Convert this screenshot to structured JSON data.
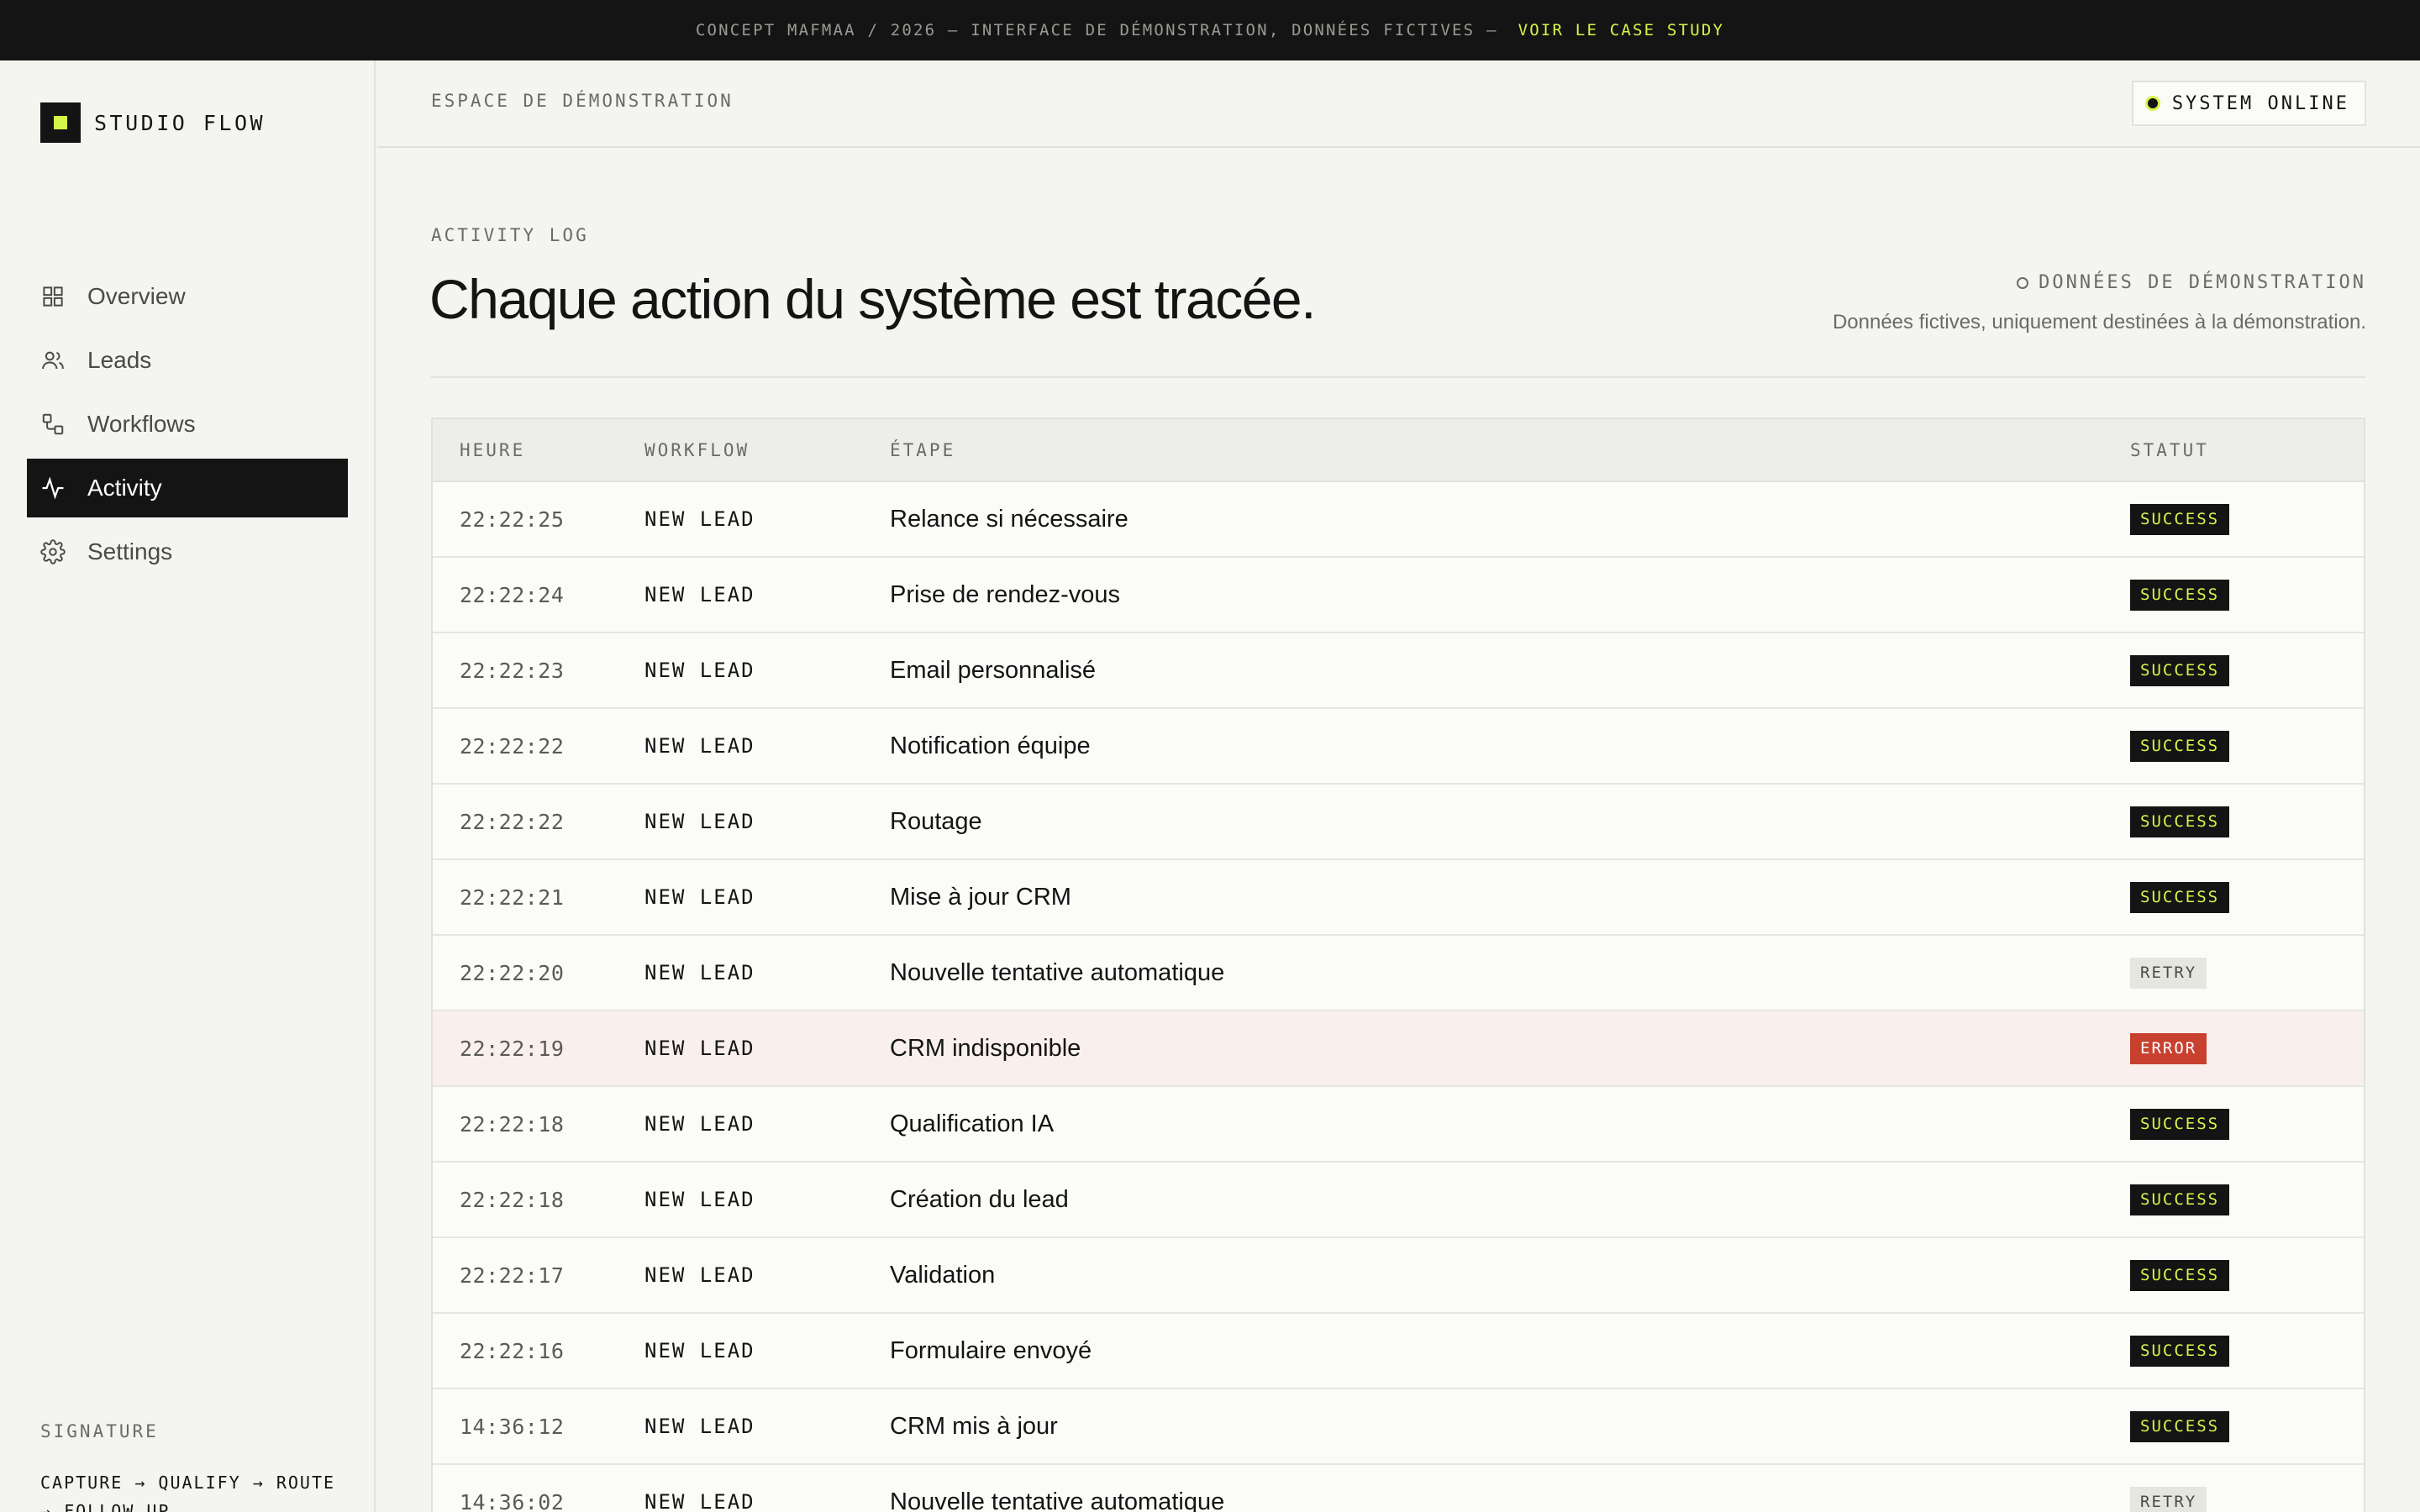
{
  "banner": {
    "text": "CONCEPT MAFMAA / 2026 — INTERFACE DE DÉMONSTRATION, DONNÉES FICTIVES —",
    "link": "VOIR LE CASE STUDY"
  },
  "sidebar": {
    "brand": "STUDIO FLOW",
    "items": [
      {
        "label": "Overview",
        "icon": "grid-icon",
        "active": false
      },
      {
        "label": "Leads",
        "icon": "users-icon",
        "active": false
      },
      {
        "label": "Workflows",
        "icon": "workflow-icon",
        "active": false
      },
      {
        "label": "Activity",
        "icon": "activity-icon",
        "active": true
      },
      {
        "label": "Settings",
        "icon": "gear-icon",
        "active": false
      }
    ],
    "signature_label": "SIGNATURE",
    "signature_flow": "CAPTURE → QUALIFY → ROUTE → FOLLOW UP"
  },
  "header": {
    "workspace": "ESPACE DE DÉMONSTRATION",
    "status": "SYSTEM ONLINE"
  },
  "main": {
    "eyebrow": "ACTIVITY LOG",
    "title": "Chaque action du système est tracée.",
    "demo_tag": "DONNÉES DE DÉMONSTRATION",
    "demo_note": "Données fictives, uniquement destinées à la démonstration."
  },
  "table": {
    "columns": [
      "HEURE",
      "WORKFLOW",
      "ÉTAPE",
      "STATUT"
    ],
    "rows": [
      {
        "time": "22:22:25",
        "workflow": "NEW LEAD",
        "step": "Relance si nécessaire",
        "status": "SUCCESS"
      },
      {
        "time": "22:22:24",
        "workflow": "NEW LEAD",
        "step": "Prise de rendez-vous",
        "status": "SUCCESS"
      },
      {
        "time": "22:22:23",
        "workflow": "NEW LEAD",
        "step": "Email personnalisé",
        "status": "SUCCESS"
      },
      {
        "time": "22:22:22",
        "workflow": "NEW LEAD",
        "step": "Notification équipe",
        "status": "SUCCESS"
      },
      {
        "time": "22:22:22",
        "workflow": "NEW LEAD",
        "step": "Routage",
        "status": "SUCCESS"
      },
      {
        "time": "22:22:21",
        "workflow": "NEW LEAD",
        "step": "Mise à jour CRM",
        "status": "SUCCESS"
      },
      {
        "time": "22:22:20",
        "workflow": "NEW LEAD",
        "step": "Nouvelle tentative automatique",
        "status": "RETRY"
      },
      {
        "time": "22:22:19",
        "workflow": "NEW LEAD",
        "step": "CRM indisponible",
        "status": "ERROR"
      },
      {
        "time": "22:22:18",
        "workflow": "NEW LEAD",
        "step": "Qualification IA",
        "status": "SUCCESS"
      },
      {
        "time": "22:22:18",
        "workflow": "NEW LEAD",
        "step": "Création du lead",
        "status": "SUCCESS"
      },
      {
        "time": "22:22:17",
        "workflow": "NEW LEAD",
        "step": "Validation",
        "status": "SUCCESS"
      },
      {
        "time": "22:22:16",
        "workflow": "NEW LEAD",
        "step": "Formulaire envoyé",
        "status": "SUCCESS"
      },
      {
        "time": "14:36:12",
        "workflow": "NEW LEAD",
        "step": "CRM mis à jour",
        "status": "SUCCESS"
      },
      {
        "time": "14:36:02",
        "workflow": "NEW LEAD",
        "step": "Nouvelle tentative automatique",
        "status": "RETRY"
      }
    ]
  },
  "colors": {
    "accent": "#d6f54a",
    "ink": "#141414",
    "error": "#c8412e",
    "error_row": "#f9efec",
    "background": "#f4f4f0"
  }
}
